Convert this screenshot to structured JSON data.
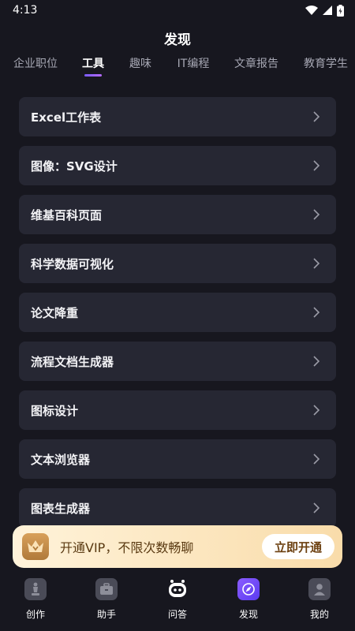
{
  "status": {
    "time": "4:13"
  },
  "header": {
    "title": "发现"
  },
  "tabs": [
    {
      "label": "企业职位"
    },
    {
      "label": "工具"
    },
    {
      "label": "趣味"
    },
    {
      "label": "IT编程"
    },
    {
      "label": "文章报告"
    },
    {
      "label": "教育学生"
    }
  ],
  "active_tab": "工具",
  "list": [
    {
      "label": "Excel工作表"
    },
    {
      "label": "图像：SVG设计"
    },
    {
      "label": "维基百科页面"
    },
    {
      "label": "科学数据可视化"
    },
    {
      "label": "论文降重"
    },
    {
      "label": "流程文档生成器"
    },
    {
      "label": "图标设计"
    },
    {
      "label": "文本浏览器"
    },
    {
      "label": "图表生成器"
    }
  ],
  "vip_banner": {
    "text": "开通VIP，不限次数畅聊",
    "button": "立即开通"
  },
  "bottom_nav": [
    {
      "label": "创作",
      "icon": "chess-icon"
    },
    {
      "label": "助手",
      "icon": "briefcase-icon"
    },
    {
      "label": "问答",
      "icon": "robot-icon"
    },
    {
      "label": "发现",
      "icon": "compass-icon"
    },
    {
      "label": "我的",
      "icon": "user-icon"
    }
  ],
  "colors": {
    "background": "#17171f",
    "card": "#262733",
    "accent": "#7a5cff",
    "vip": "#f9dcaa"
  }
}
